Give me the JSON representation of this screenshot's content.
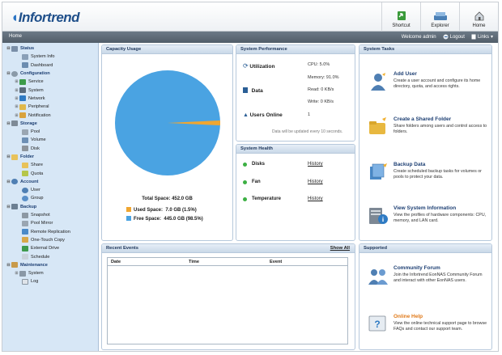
{
  "header": {
    "logo": "Infortrend",
    "nav": [
      {
        "label": "Shortcut",
        "icon": "shortcut-icon"
      },
      {
        "label": "Explorer",
        "icon": "explorer-icon"
      },
      {
        "label": "Home",
        "icon": "home-icon"
      }
    ]
  },
  "subbar": {
    "breadcrumb": "Home",
    "welcome": "Welcome admin",
    "logout": "Logout",
    "links": "Links"
  },
  "sidebar": {
    "groups": [
      {
        "label": "Status",
        "items": [
          "System Info",
          "Dashboard"
        ]
      },
      {
        "label": "Configuration",
        "items": [
          "Service",
          "System",
          "Network",
          "Peripheral",
          "Notification"
        ]
      },
      {
        "label": "Storage",
        "items": [
          "Pool",
          "Volume",
          "Disk"
        ]
      },
      {
        "label": "Folder",
        "items": [
          "Share",
          "Quota"
        ]
      },
      {
        "label": "Account",
        "items": [
          "User",
          "Group"
        ]
      },
      {
        "label": "Backup",
        "items": [
          "Snapshot",
          "Pool Mirror",
          "Remote Replication",
          "One-Touch Copy",
          "External Drive",
          "Schedule"
        ]
      },
      {
        "label": "Maintenance",
        "items": [
          "System",
          "Log"
        ]
      }
    ]
  },
  "capacity": {
    "title": "Capacity Usage",
    "total": "Total Space: 452.0 GB",
    "used": "Used Space:  7.0 GB (1.5%)",
    "free": "Free Space:  445.0 GB (98.5%)",
    "used_fraction": 0.015,
    "used_color": "#f0a630",
    "free_color": "#4aa3e2"
  },
  "performance": {
    "title": "System Performance",
    "utilization_label": "Utilization",
    "cpu": "CPU: 5.0%",
    "memory": "Memory: 91.0%",
    "data_label": "Data",
    "read": "Read: 0 KB/s",
    "write": "Write: 0 KB/s",
    "users_label": "Users Online",
    "users_value": "1",
    "note": "Data will be updated every 10 seconds."
  },
  "health": {
    "title": "System Health",
    "rows": [
      {
        "label": "Disks",
        "link": "History"
      },
      {
        "label": "Fan",
        "link": "History"
      },
      {
        "label": "Temperature",
        "link": "History"
      }
    ],
    "ok_color": "#3cb043"
  },
  "tasks": {
    "title": "System Tasks",
    "items": [
      {
        "title": "Add User",
        "desc": "Create a user account and configure its home directory, quota, and access rights."
      },
      {
        "title": "Create a Shared Folder",
        "desc": "Share folders among users and control access to folders."
      },
      {
        "title": "Backup Data",
        "desc": "Create scheduled backup tasks for volumes or pools to protect your data."
      },
      {
        "title": "View System Information",
        "desc": "View the profiles of hardware components: CPU, memory, and LAN card."
      }
    ]
  },
  "events": {
    "title": "Recent Events",
    "show_all": "Show All",
    "columns": [
      "Date",
      "Time",
      "Event"
    ]
  },
  "supported": {
    "title": "Supported",
    "items": [
      {
        "title": "Community Forum",
        "desc": "Join the Infortrend EonNAS Community Forum and interact with other EonNAS users."
      },
      {
        "title": "Online Help",
        "desc": "View the online technical support page to browse FAQs and contact our support team."
      }
    ]
  }
}
